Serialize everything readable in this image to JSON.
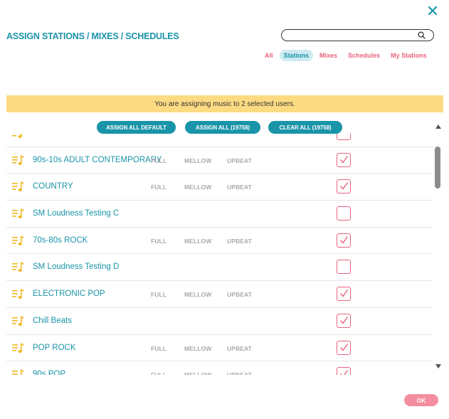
{
  "dialog": {
    "title": "ASSIGN STATIONS / MIXES / SCHEDULES",
    "close_symbol": "✕"
  },
  "search": {
    "value": "",
    "placeholder": "",
    "icon": "search-icon"
  },
  "filter_tabs": [
    {
      "label": "All",
      "active": false
    },
    {
      "label": "Stations",
      "active": true
    },
    {
      "label": "Mixes",
      "active": false
    },
    {
      "label": "Schedules",
      "active": false
    },
    {
      "label": "My Stations",
      "active": false
    }
  ],
  "banner": {
    "text": "You are assigning music to 2 selected users."
  },
  "bulk_actions": {
    "assign_default": "ASSIGN ALL DEFAULT",
    "assign_all": "ASSIGN ALL (19758)",
    "clear_all": "CLEAR ALL (19758)"
  },
  "list": {
    "icon": "music-list-icon",
    "option_labels": {
      "full": "FULL",
      "mellow": "MELLOW",
      "upbeat": "UPBEAT"
    },
    "rows": [
      {
        "name": "",
        "has_options": false,
        "checked": false
      },
      {
        "name": "90s-10s ADULT CONTEMPORARY",
        "has_options": true,
        "checked": true
      },
      {
        "name": "COUNTRY",
        "has_options": true,
        "checked": true
      },
      {
        "name": "SM Loudness Testing C",
        "has_options": false,
        "checked": false
      },
      {
        "name": "70s-80s ROCK",
        "has_options": true,
        "checked": true
      },
      {
        "name": "SM Loudness Testing D",
        "has_options": false,
        "checked": false
      },
      {
        "name": "ELECTRONIC POP",
        "has_options": true,
        "checked": true
      },
      {
        "name": "Chill Beats",
        "has_options": false,
        "checked": true
      },
      {
        "name": "POP ROCK",
        "has_options": true,
        "checked": true
      },
      {
        "name": "90s POP",
        "has_options": true,
        "checked": true
      }
    ]
  },
  "footer": {
    "ok_label": "OK"
  },
  "colors": {
    "teal": "#1a94a8",
    "pink": "#e8637d",
    "banner": "#fddb83",
    "icon_yellow": "#f2b824",
    "option_gray": "#aaaaaa"
  }
}
